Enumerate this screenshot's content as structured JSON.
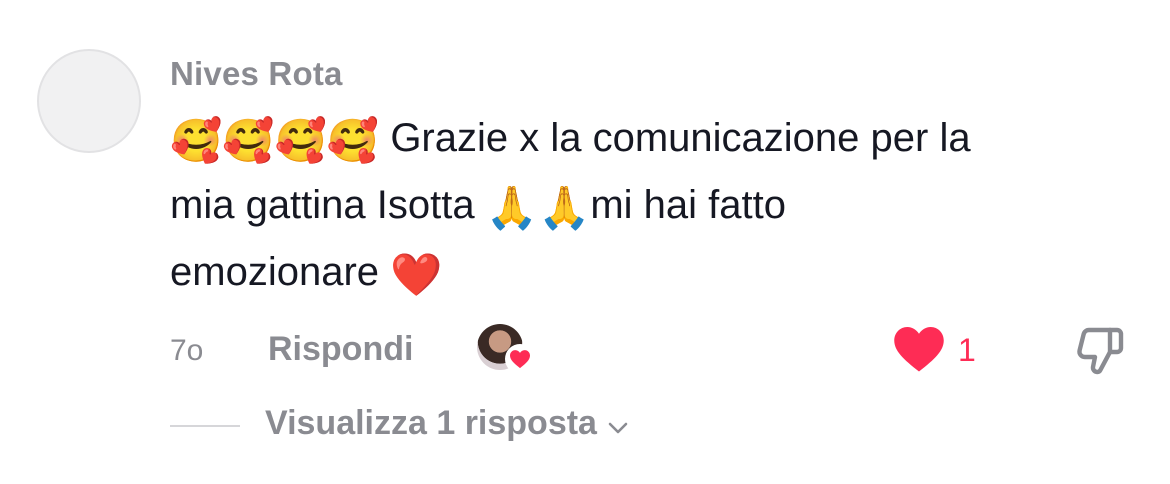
{
  "comment": {
    "username": "Nives Rota",
    "text_line1": "Grazie x la comunicazione per la",
    "text_line2_a": "mia gattina Isotta",
    "text_line2_b": "mi hai fatto",
    "text_line3": "emozionare",
    "emoji_smiling_hearts": "🥰",
    "emoji_folded_hands": "🙏",
    "emoji_red_heart": "❤️",
    "timestamp": "7o",
    "reply_label": "Rispondi",
    "like_count": "1",
    "view_replies_label": "Visualizza 1 risposta"
  },
  "icons": {
    "like": "heart-icon",
    "dislike": "thumbs-down-icon",
    "creator_liked": "creator-heart-icon",
    "expand": "chevron-down-icon"
  },
  "colors": {
    "text_primary": "#161823",
    "text_secondary": "#8a8b91",
    "accent_red": "#fe2c55"
  }
}
